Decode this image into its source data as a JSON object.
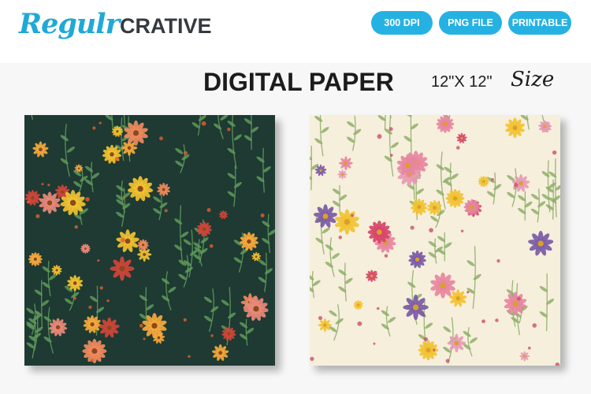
{
  "brand": {
    "script": "Regulr",
    "bold": "CRATIVE"
  },
  "badges": [
    "300 DPI",
    "PNG FILE",
    "PRINTABLE"
  ],
  "title": "DIGITAL PAPER",
  "size": {
    "dimensions": "12\"X 12\"",
    "label": "Size"
  },
  "papers": [
    {
      "name": "dark-floral-paper",
      "background": "#1e3a33",
      "flower_colors": [
        "#f2c230",
        "#f6a93b",
        "#f08a5d",
        "#e9897a",
        "#d0453a"
      ]
    },
    {
      "name": "light-floral-paper",
      "background": "#f6efdc",
      "flower_colors": [
        "#d6456a",
        "#e69ab2",
        "#7a5aa6",
        "#f1c232",
        "#e7859f"
      ]
    }
  ]
}
